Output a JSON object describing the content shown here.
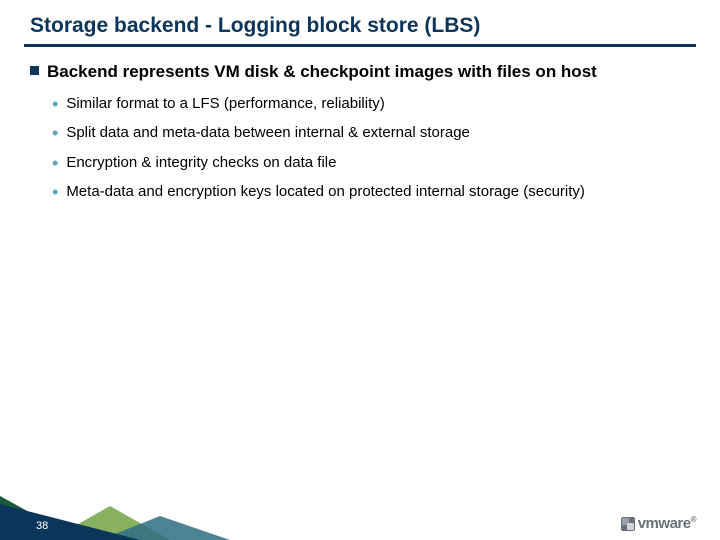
{
  "title": "Storage backend - Logging block store (LBS)",
  "heading": "Backend represents VM disk & checkpoint images with files on host",
  "sub": [
    "Similar format to a LFS (performance, reliability)",
    "Split data and meta-data between internal & external storage",
    "Encryption & integrity checks on data file",
    "Meta-data and encryption keys located on protected internal storage (security)"
  ],
  "page_number": "38",
  "logo_text": "vmware"
}
